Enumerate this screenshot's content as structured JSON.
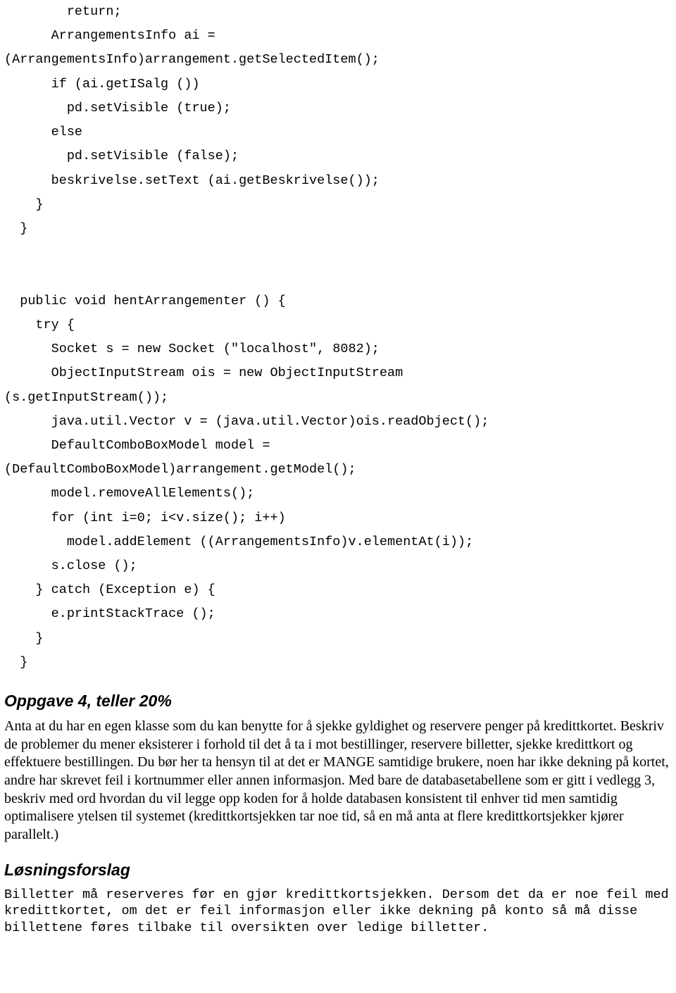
{
  "code_block": "        return;\n      ArrangementsInfo ai =\n(ArrangementsInfo)arrangement.getSelectedItem();\n      if (ai.getISalg ())\n        pd.setVisible (true);\n      else\n        pd.setVisible (false);\n      beskrivelse.setText (ai.getBeskrivelse());\n    }\n  }\n\n\n  public void hentArrangementer () {\n    try {\n      Socket s = new Socket (\"localhost\", 8082);\n      ObjectInputStream ois = new ObjectInputStream\n(s.getInputStream());\n      java.util.Vector v = (java.util.Vector)ois.readObject();\n      DefaultComboBoxModel model =\n(DefaultComboBoxModel)arrangement.getModel();\n      model.removeAllElements();\n      for (int i=0; i<v.size(); i++)\n        model.addElement ((ArrangementsInfo)v.elementAt(i));\n      s.close ();\n    } catch (Exception e) {\n      e.printStackTrace ();\n    }\n  }",
  "section4_heading": "Oppgave 4, teller 20%",
  "section4_body": "Anta at du har en egen klasse som du kan benytte for å sjekke gyldighet og reservere penger på kredittkortet. Beskriv de problemer du mener eksisterer i forhold til det å ta i mot bestillinger, reservere billetter, sjekke kredittkort og effektuere bestillingen. Du bør her ta hensyn til at det er MANGE samtidige brukere, noen har ikke dekning på kortet, andre har skrevet feil i kortnummer eller annen informasjon. Med bare de databasetabellene som er gitt i vedlegg 3, beskriv med ord hvordan du vil legge opp koden for å holde databasen konsistent til enhver tid men samtidig optimalisere ytelsen til systemet (kredittkortsjekken tar noe tid, så en må anta at flere kredittkortsjekker kjører parallelt.)",
  "solution_heading": "Løsningsforslag",
  "solution_body": "Billetter må reserveres før en gjør kredittkortsjekken. Dersom det da er noe feil med kredittkortet, om det er feil informasjon eller ikke dekning på konto så må disse billettene føres tilbake til oversikten over ledige billetter."
}
